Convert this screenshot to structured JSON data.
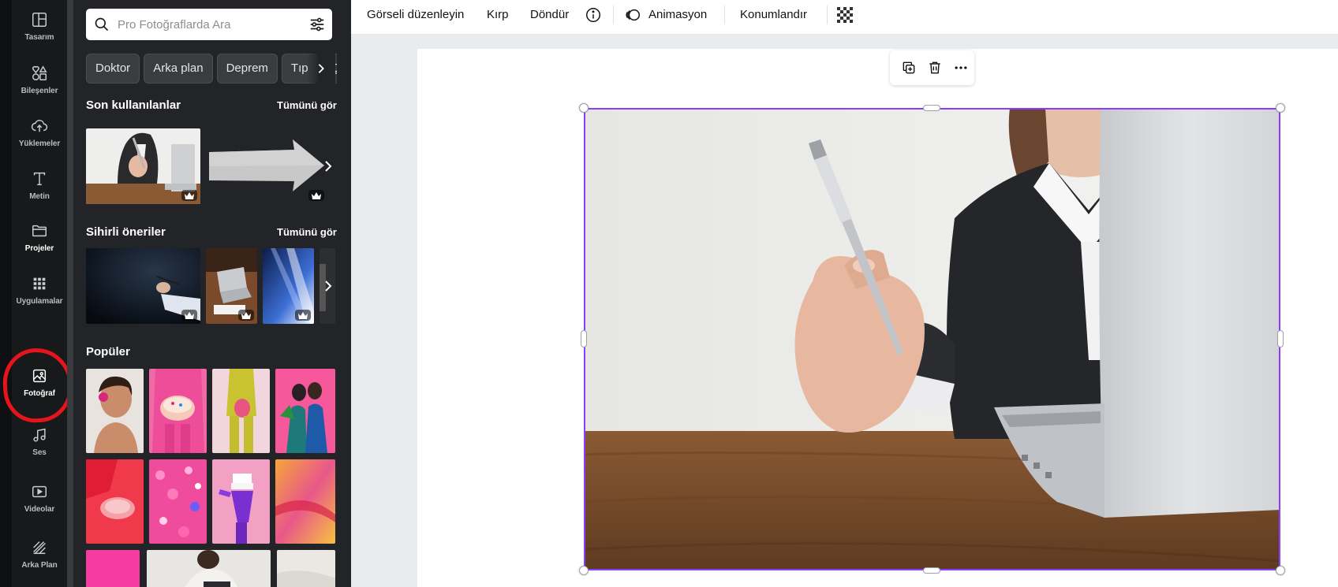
{
  "rail": {
    "items": [
      {
        "label": "Tasarım",
        "icon": "layout-icon"
      },
      {
        "label": "Bileşenler",
        "icon": "shapes-icon"
      },
      {
        "label": "Yüklemeler",
        "icon": "cloud-upload-icon"
      },
      {
        "label": "Metin",
        "icon": "text-icon"
      },
      {
        "label": "Projeler",
        "icon": "folder-icon"
      },
      {
        "label": "Uygulamalar",
        "icon": "apps-grid-icon"
      },
      {
        "label": "Fotoğraf",
        "icon": "image-icon"
      },
      {
        "label": "Ses",
        "icon": "music-note-icon"
      },
      {
        "label": "Videolar",
        "icon": "video-icon"
      },
      {
        "label": "Arka Plan",
        "icon": "background-pattern-icon"
      }
    ],
    "active": "Fotoğraf"
  },
  "panel": {
    "search": {
      "placeholder": "Pro Fotoğraflarda Ara"
    },
    "chips": [
      "Doktor",
      "Arka plan",
      "Deprem",
      "Tıp",
      "Çocuk"
    ],
    "recent": {
      "title": "Son kullanılanlar",
      "see_all": "Tümünü gör"
    },
    "magic": {
      "title": "Sihirli öneriler",
      "see_all": "Tümünü gör"
    },
    "popular": {
      "title": "Popüler"
    }
  },
  "toolbar": {
    "edit_image": "Görseli düzenleyin",
    "crop": "Kırp",
    "rotate": "Döndür",
    "animate": "Animasyon",
    "position": "Konumlandır"
  },
  "colors": {
    "accent": "#8b3dff",
    "rail_bg": "#18191b",
    "panel_bg": "#232427",
    "highlight": "#e8141c"
  }
}
